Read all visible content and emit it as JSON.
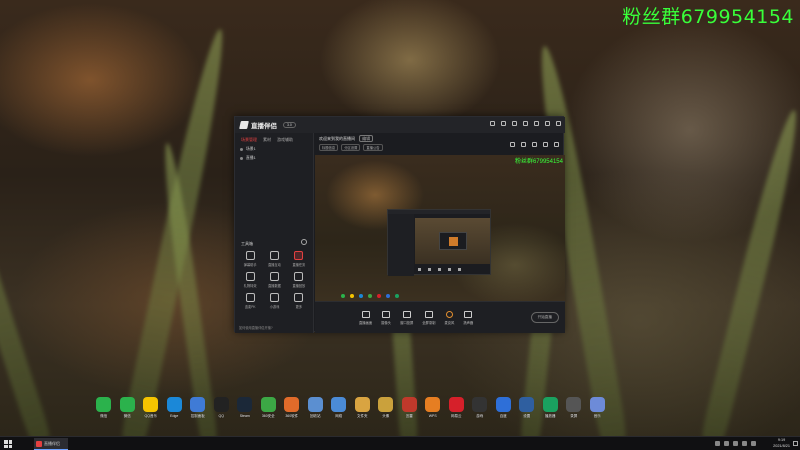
{
  "overlay": {
    "watermark": "粉丝群679954154"
  },
  "app": {
    "name": "直播伴侣",
    "version_badge": "3.0",
    "left_tabs": [
      "场景管理",
      "素材",
      "游戏辅助"
    ],
    "scenes": [
      "场景1",
      "直播1"
    ],
    "tools_header": "工具箱",
    "tools": [
      {
        "label": "弹幕助手",
        "icon": "chat-icon",
        "highlight": false
      },
      {
        "label": "直播互动",
        "icon": "interaction-icon",
        "highlight": false
      },
      {
        "label": "直播任务",
        "icon": "task-icon",
        "highlight": true
      },
      {
        "label": "礼物特效",
        "icon": "gift-icon",
        "highlight": false
      },
      {
        "label": "直播数据",
        "icon": "data-icon",
        "highlight": false
      },
      {
        "label": "直播回放",
        "icon": "replay-icon",
        "highlight": false
      },
      {
        "label": "连麦PK",
        "icon": "pk-icon",
        "highlight": false
      },
      {
        "label": "小游戏",
        "icon": "game-icon",
        "highlight": false
      },
      {
        "label": "更多",
        "icon": "more-icon",
        "highlight": false
      }
    ],
    "left_footer": "如何使用直播伴侣开播?",
    "room": {
      "title": "欢迎来到我的直播间",
      "tag": "编辑",
      "sub_tags": [
        "标题信息",
        "分区设置",
        "直播公告"
      ]
    },
    "preview_watermark": "粉丝群679954154",
    "controls": [
      {
        "label": "直播画面",
        "icon": "screen-icon"
      },
      {
        "label": "摄像头",
        "icon": "camera-icon"
      },
      {
        "label": "窗口投屏",
        "icon": "window-icon"
      },
      {
        "label": "全屏录制",
        "icon": "fullscreen-icon"
      },
      {
        "label": "麦克风",
        "icon": "mic-icon"
      },
      {
        "label": "扬声器",
        "icon": "speaker-icon"
      }
    ],
    "go_live_label": "开始直播"
  },
  "desktop_icons": [
    {
      "label": "微信",
      "icon": "wechat-icon",
      "color": "#2bb24c"
    },
    {
      "label": "微信",
      "icon": "wechat-icon",
      "color": "#2bb24c"
    },
    {
      "label": "QQ音乐",
      "icon": "qqmusic-icon",
      "color": "#f5c400"
    },
    {
      "label": "Edge",
      "icon": "edge-icon",
      "color": "#1b88d8"
    },
    {
      "label": "控制面板",
      "icon": "control-panel-icon",
      "color": "#3f7bd6"
    },
    {
      "label": "QQ",
      "icon": "qq-icon",
      "color": "#222222"
    },
    {
      "label": "Steam",
      "icon": "steam-icon",
      "color": "#1b2838"
    },
    {
      "label": "360安全",
      "icon": "360-icon",
      "color": "#3ca845"
    },
    {
      "label": "360软件",
      "icon": "software-icon",
      "color": "#e06b2a"
    },
    {
      "label": "回收站",
      "icon": "recycle-bin-icon",
      "color": "#5b8fd1"
    },
    {
      "label": "网络",
      "icon": "network-icon",
      "color": "#4b8bd6"
    },
    {
      "label": "文件夹",
      "icon": "folder-icon",
      "color": "#d9a441"
    },
    {
      "label": "头像",
      "icon": "avatar-icon",
      "color": "#caa13c"
    },
    {
      "label": "迅雷",
      "icon": "thunder-icon",
      "color": "#c0392b"
    },
    {
      "label": "WPS",
      "icon": "wps-icon",
      "color": "#e67e22"
    },
    {
      "label": "网易云",
      "icon": "netease-icon",
      "color": "#d6202a"
    },
    {
      "label": "游戏",
      "icon": "game-icon",
      "color": "#333333"
    },
    {
      "label": "百度",
      "icon": "baidu-icon",
      "color": "#2e6fd8"
    },
    {
      "label": "设置",
      "icon": "settings-icon",
      "color": "#2f5fa0"
    },
    {
      "label": "播放器",
      "icon": "player-icon",
      "color": "#1aa260"
    },
    {
      "label": "录屏",
      "icon": "recorder-icon",
      "color": "#555555"
    },
    {
      "label": "音乐",
      "icon": "music-icon",
      "color": "#6d8bd8"
    }
  ],
  "taskbar": {
    "app_label": "直播伴侣",
    "time": "9:19",
    "date": "2021/8/21"
  }
}
